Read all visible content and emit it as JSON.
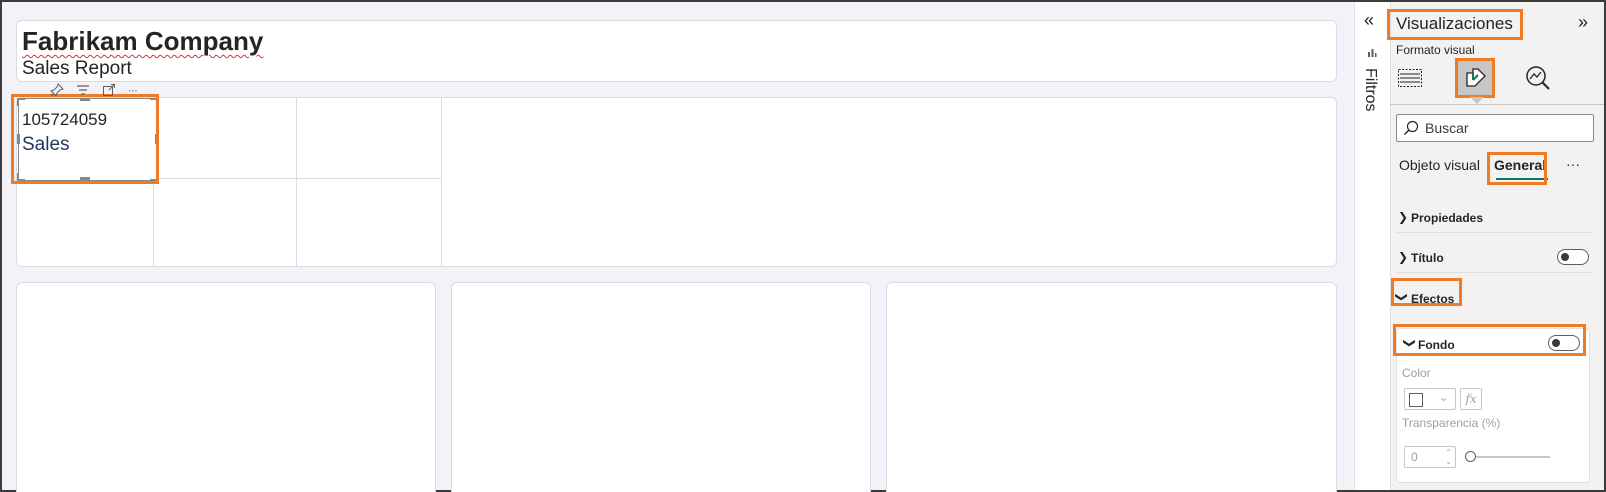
{
  "report": {
    "title": "Fabrikam Company",
    "subtitle": "Sales Report"
  },
  "card": {
    "value": "105724059",
    "label": "Sales"
  },
  "visual_toolbar": {
    "icons": [
      "pin-icon",
      "filter-icon",
      "focus-mode-icon",
      "more-options-icon"
    ],
    "more_label": "···"
  },
  "filters_pane": {
    "collapse_glyph": "«",
    "label": "Filtros"
  },
  "panel": {
    "title": "Visualizaciones",
    "expand_glyph": "»",
    "subtitle": "Formato visual",
    "icon_tabs": [
      "build-visual-icon",
      "format-visual-icon",
      "analytics-icon"
    ],
    "search_placeholder": "Buscar",
    "tabs": [
      "Objeto visual",
      "General"
    ],
    "active_tab": "General",
    "more_label": "···",
    "sections": {
      "propiedades": "Propiedades",
      "titulo": "Título",
      "efectos": "Efectos"
    },
    "fondo": {
      "label": "Fondo",
      "color_label": "Color",
      "fx_label": "fx",
      "transparency_label": "Transparencia (%)",
      "transparency_value": "0"
    },
    "toggles": {
      "titulo": false,
      "fondo": false
    }
  },
  "colors": {
    "highlight": "#f07b26",
    "accent": "#117865",
    "canvas": "#f3f2f8",
    "card_label": "#1e3a5c"
  }
}
